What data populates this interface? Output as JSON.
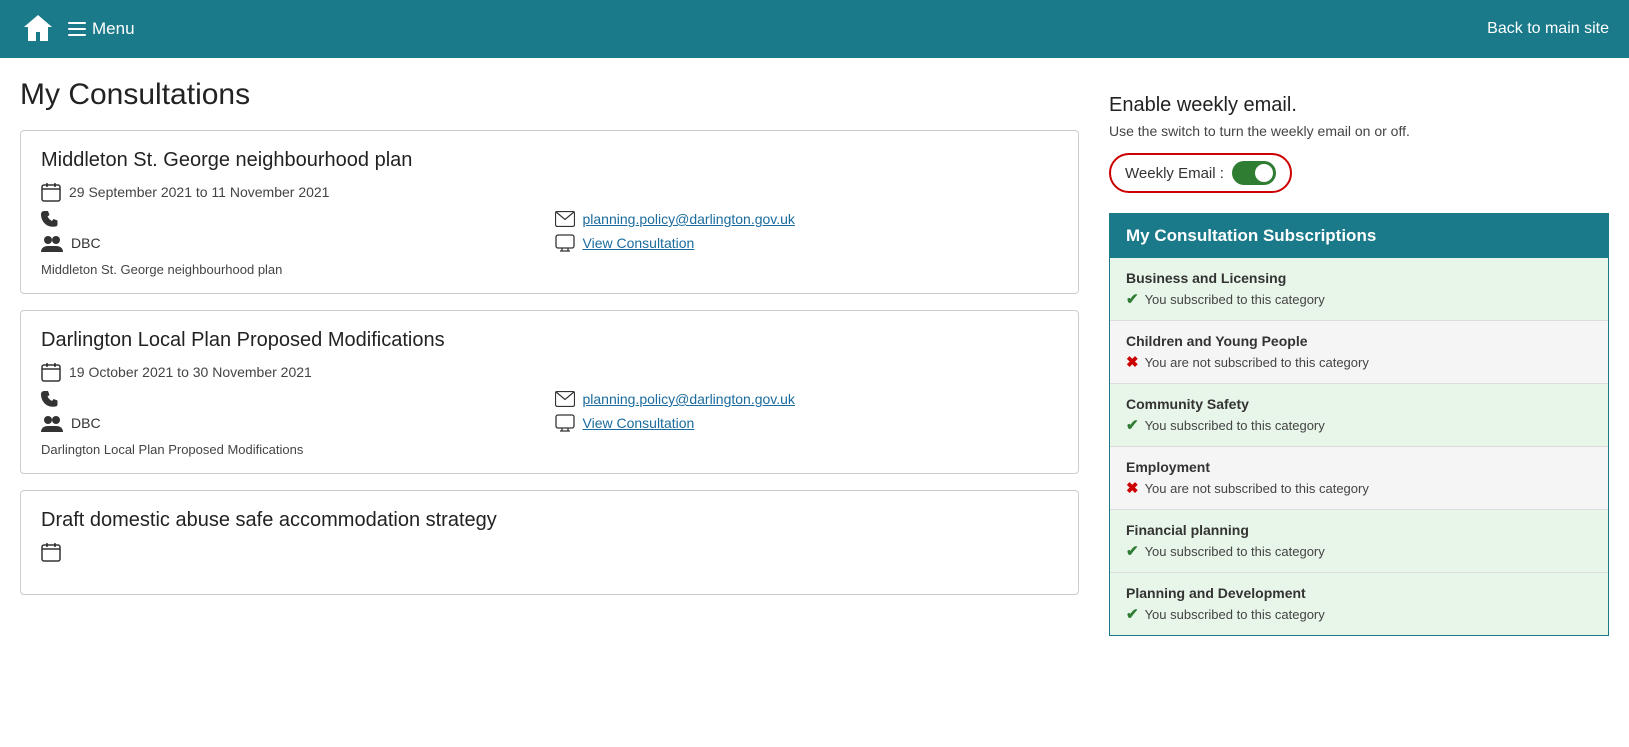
{
  "header": {
    "home_icon_alt": "home",
    "menu_label": "Menu",
    "back_link": "Back to main site"
  },
  "page": {
    "title": "My Consultations"
  },
  "consultations": [
    {
      "id": 1,
      "title": "Middleton St. George neighbourhood plan",
      "date": "29 September 2021 to 11 November 2021",
      "email": "planning.policy@darlington.gov.uk",
      "view_label": "View Consultation",
      "org": "DBC",
      "description": "Middleton St. George neighbourhood plan"
    },
    {
      "id": 2,
      "title": "Darlington Local Plan Proposed Modifications",
      "date": "19 October 2021 to 30 November 2021",
      "email": "planning.policy@darlington.gov.uk",
      "view_label": "View Consultation",
      "org": "DBC",
      "description": "Darlington Local Plan Proposed Modifications"
    },
    {
      "id": 3,
      "title": "Draft domestic abuse safe accommodation strategy",
      "date": "",
      "email": "",
      "view_label": "",
      "org": "",
      "description": ""
    }
  ],
  "weekly_email": {
    "title": "Enable weekly email.",
    "description": "Use the switch to turn the weekly email on or off.",
    "label": "Weekly Email :",
    "enabled": true
  },
  "subscriptions": {
    "header": "My Consultation Subscriptions",
    "items": [
      {
        "name": "Business and Licensing",
        "subscribed": true,
        "subscribed_text": "You subscribed to this category",
        "not_subscribed_text": "You are not subscribed to this category"
      },
      {
        "name": "Children and Young People",
        "subscribed": false,
        "subscribed_text": "You subscribed to this category",
        "not_subscribed_text": "You are not subscribed to this category"
      },
      {
        "name": "Community Safety",
        "subscribed": true,
        "subscribed_text": "You subscribed to this category",
        "not_subscribed_text": "You are not subscribed to this category"
      },
      {
        "name": "Employment",
        "subscribed": false,
        "subscribed_text": "You subscribed to this category",
        "not_subscribed_text": "You are not subscribed to this category"
      },
      {
        "name": "Financial planning",
        "subscribed": true,
        "subscribed_text": "You subscribed to this category",
        "not_subscribed_text": "You are not subscribed to this category"
      },
      {
        "name": "Planning and Development",
        "subscribed": true,
        "subscribed_text": "You subscribed to this category",
        "not_subscribed_text": "You are not subscribed to this category"
      }
    ]
  }
}
